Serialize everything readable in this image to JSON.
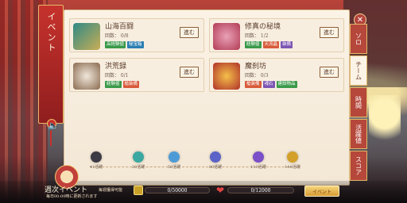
{
  "sidebar": {
    "title": "イベント",
    "tabs": [
      {
        "label": "ソロ",
        "active": false
      },
      {
        "label": "チーム",
        "active": true
      },
      {
        "label": "時間",
        "active": false
      },
      {
        "label": "活躍値",
        "active": false
      },
      {
        "label": "スコア",
        "active": false
      }
    ]
  },
  "cards": [
    {
      "title": "山海百闘",
      "count": "回数： 0/8",
      "tags": [
        {
          "text": "高経験値",
          "color": "#3a9a4a"
        },
        {
          "text": "秘宝箱",
          "color": "#2b7fb2"
        }
      ],
      "button": "進む"
    },
    {
      "title": "修真の秘境",
      "count": "回数： 1/2",
      "tags": [
        {
          "text": "経験値",
          "color": "#3a9a4a"
        },
        {
          "text": "天流晶",
          "color": "#d85b3b"
        },
        {
          "text": "装備",
          "color": "#7d56b3"
        }
      ],
      "button": "進む"
    },
    {
      "title": "洪荒録",
      "count": "回数： 0/1",
      "tags": [
        {
          "text": "経験値",
          "color": "#3a9a4a"
        },
        {
          "text": "槍装備",
          "color": "#d85b3b"
        }
      ],
      "button": "進む"
    },
    {
      "title": "魔刹坊",
      "count": "回数： 0/3",
      "tags": [
        {
          "text": "槍装備",
          "color": "#d85b3b"
        },
        {
          "text": "魂石",
          "color": "#7d56b3"
        },
        {
          "text": "建設物品",
          "color": "#3a9a4a"
        }
      ],
      "button": "進む"
    }
  ],
  "milestones": [
    {
      "label": "41活躍",
      "color": "#3c3a44"
    },
    {
      "label": "20活躍",
      "color": "#3aa8a0"
    },
    {
      "label": "50活躍",
      "color": "#4c9bd6"
    },
    {
      "label": "80活躍",
      "color": "#5b63c8"
    },
    {
      "label": "110活躍",
      "color": "#7a4fc7"
    },
    {
      "label": "140活躍",
      "color": "#d3a02a"
    }
  ],
  "bottom": {
    "weekly_title": "週次イベント",
    "weekly_sub": "毎日00:00時に更新されます",
    "available_label": "毎週獲得可能",
    "coin_progress": "0/50000",
    "heart_progress": "0/12000",
    "event_button": "イベント"
  },
  "icons": {
    "close": "close-icon",
    "speaker": "speaker-icon",
    "coin": "coin-icon",
    "heart": "heart-icon"
  }
}
